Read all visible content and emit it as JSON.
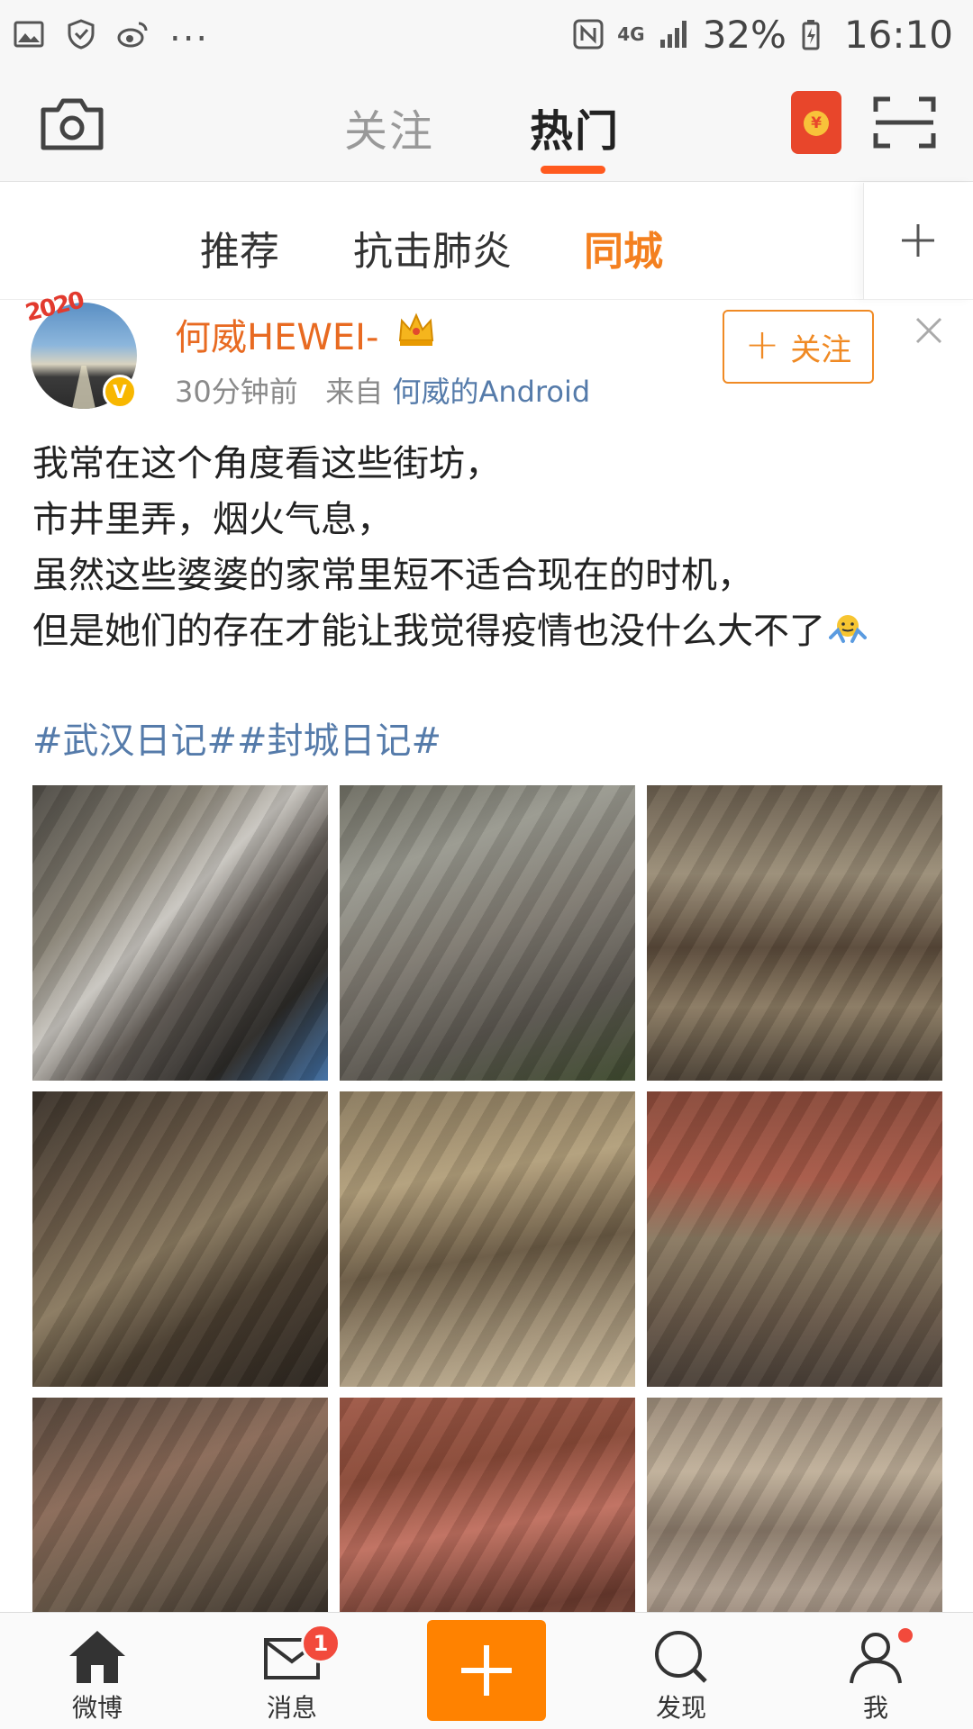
{
  "status_bar": {
    "icons": [
      "gallery-icon",
      "shield-icon",
      "weibo-icon",
      "nfc-icon",
      "signal-icon",
      "battery-icon"
    ],
    "more_dots": "...",
    "network": "4G",
    "battery": "32%",
    "time": "16:10"
  },
  "top_nav": {
    "tabs": [
      {
        "label": "关注",
        "active": false
      },
      {
        "label": "热门",
        "active": true
      }
    ],
    "accent_color": "#ff5a1f"
  },
  "sub_tabs": {
    "items": [
      {
        "label": "推荐",
        "active": false
      },
      {
        "label": "抗击肺炎",
        "active": false
      },
      {
        "label": "同城",
        "active": true
      }
    ],
    "active_color": "#f4801f"
  },
  "post": {
    "user": {
      "name": "何威HEWEI-",
      "badge_year": "2020",
      "verified": true
    },
    "time_ago": "30分钟前",
    "from_label": "来自",
    "source": "何威的Android",
    "follow_label": "关注",
    "text_lines": [
      "我常在这个角度看这些街坊，",
      "市井里弄，烟火气息，",
      "虽然这些婆婆的家常里短不适合现在的时机，",
      "但是她们的存在才能让我觉得疫情也没什么大不了"
    ],
    "hashtags": "#武汉日记##封城日记#",
    "photos": [
      "street-car-photo",
      "elderly-walking-photo",
      "balcony-photo",
      "bicycle-wall-photo",
      "laundry-balcony-photo",
      "tiled-roof-photo",
      "shared-bike-photo",
      "rooftops-photo",
      "apartment-facade-photo"
    ]
  },
  "bottom_nav": {
    "items": [
      {
        "label": "微博",
        "icon": "home-icon"
      },
      {
        "label": "消息",
        "icon": "mail-icon",
        "badge": "1"
      },
      {
        "label": "",
        "icon": "compose-plus-icon"
      },
      {
        "label": "发现",
        "icon": "search-icon"
      },
      {
        "label": "我",
        "icon": "profile-icon"
      }
    ],
    "compose_color": "#ff8200",
    "badge_color": "#f24a3c"
  }
}
